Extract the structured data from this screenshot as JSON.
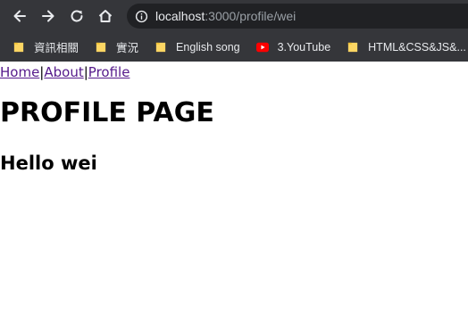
{
  "browser": {
    "url_host": "localhost",
    "url_path": ":3000/profile/wei",
    "icons": {
      "back": "arrow-left-icon",
      "forward": "arrow-right-icon",
      "reload": "reload-icon",
      "home": "home-icon",
      "info": "info-icon"
    },
    "bookmarks": [
      {
        "label": "資訊相關",
        "icon": "folder-icon"
      },
      {
        "label": "實況",
        "icon": "folder-icon"
      },
      {
        "label": "English song",
        "icon": "folder-icon"
      },
      {
        "label": "3.YouTube",
        "icon": "youtube-icon"
      },
      {
        "label": "HTML&CSS&JS&...",
        "icon": "folder-icon"
      }
    ],
    "colors": {
      "chrome_bg": "#35363a",
      "omnibox_bg": "#202124",
      "folder_yellow": "#fdd663",
      "youtube_red": "#ff0000"
    }
  },
  "page": {
    "nav": {
      "home": "Home",
      "about": "About",
      "profile": "Profile",
      "separator": "|"
    },
    "title": "PROFILE PAGE",
    "greeting": "Hello wei"
  }
}
